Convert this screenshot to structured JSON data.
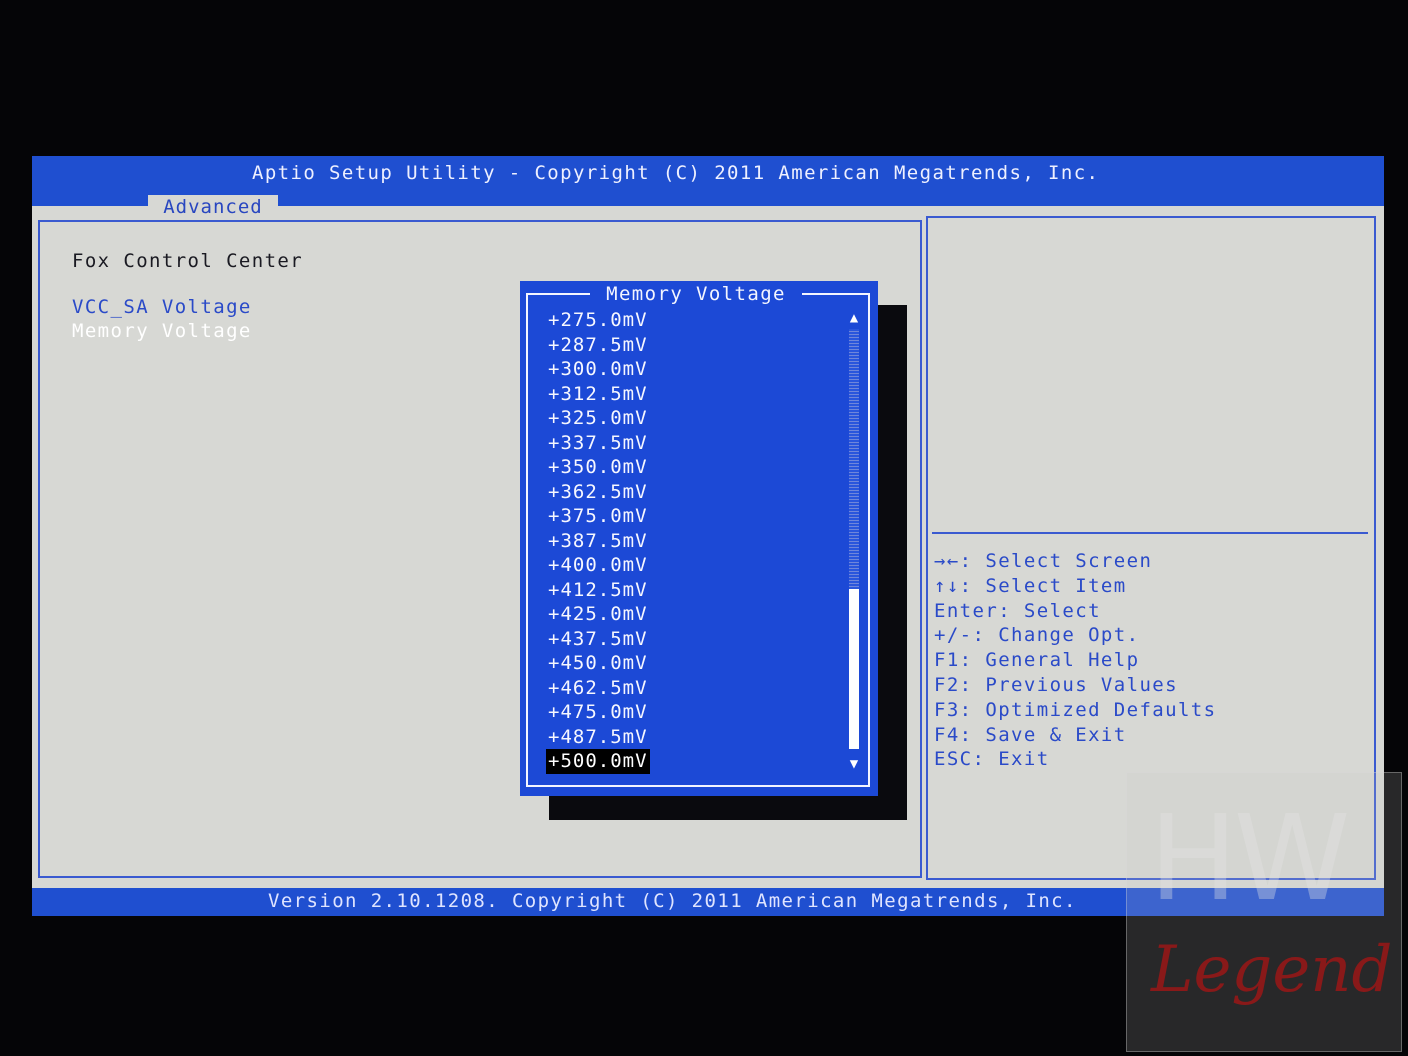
{
  "header": {
    "title": "Aptio Setup Utility - Copyright (C) 2011 American Megatrends, Inc.",
    "active_tab": "Advanced"
  },
  "main": {
    "section_title": "Fox Control Center",
    "items": [
      {
        "label": "VCC_SA Voltage"
      },
      {
        "label": "Memory Voltage"
      }
    ]
  },
  "popup": {
    "title": "Memory Voltage",
    "options": [
      "+275.0mV",
      "+287.5mV",
      "+300.0mV",
      "+312.5mV",
      "+325.0mV",
      "+337.5mV",
      "+350.0mV",
      "+362.5mV",
      "+375.0mV",
      "+387.5mV",
      "+400.0mV",
      "+412.5mV",
      "+425.0mV",
      "+437.5mV",
      "+450.0mV",
      "+462.5mV",
      "+475.0mV",
      "+487.5mV",
      "+500.0mV"
    ],
    "selected_index": 18,
    "scroll_thumb_start_fraction": 0.62
  },
  "help": {
    "lines": [
      {
        "key": "→←:",
        "text": " Select Screen"
      },
      {
        "key": "↑↓:",
        "text": " Select Item"
      },
      {
        "key": "Enter:",
        "text": " Select"
      },
      {
        "key": "+/-:",
        "text": " Change Opt."
      },
      {
        "key": "F1:",
        "text": " General Help"
      },
      {
        "key": "F2:",
        "text": " Previous Values"
      },
      {
        "key": "F3:",
        "text": " Optimized Defaults"
      },
      {
        "key": "F4:",
        "text": " Save & Exit"
      },
      {
        "key": "ESC:",
        "text": " Exit"
      }
    ]
  },
  "footer": {
    "text": "Version 2.10.1208. Copyright (C) 2011 American Megatrends, Inc."
  },
  "watermark": {
    "logo_top": "HW",
    "logo_bottom": "Legend"
  },
  "colors": {
    "bar_blue": "#1f4fd0",
    "panel_gray": "#d7d8d4",
    "text_blue": "#2a4ac8",
    "popup_blue": "#1c49d6"
  }
}
